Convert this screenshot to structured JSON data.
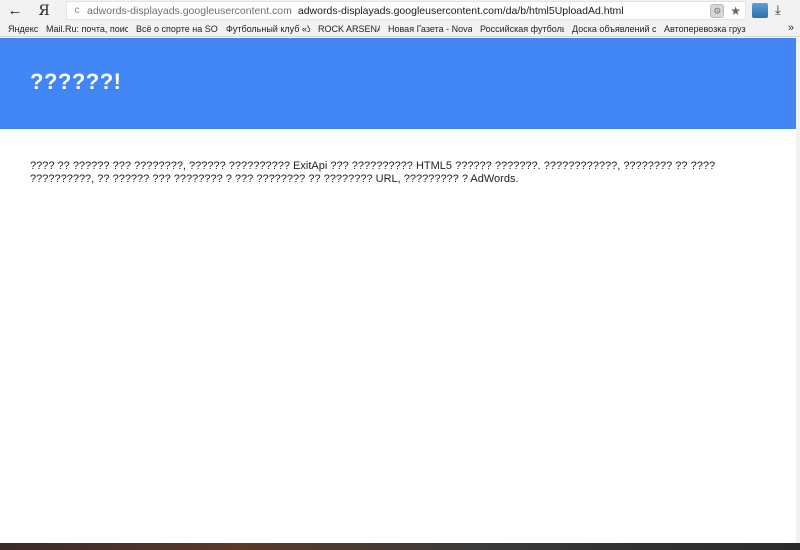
{
  "browser": {
    "back_icon": "←",
    "yandex_logo": "Я",
    "address": {
      "reload_icon": "c",
      "domain": "adwords-displayads.googleusercontent.com",
      "url": "adwords-displayads.googleusercontent.com/da/b/html5UploadAd.html"
    },
    "gear_icon": "⚙",
    "star_icon": "★",
    "download_icon": "⤓"
  },
  "bookmarks": [
    {
      "label": "Яндекс"
    },
    {
      "label": "Mail.Ru: почта, поиск"
    },
    {
      "label": "Всё о спорте на SOV"
    },
    {
      "label": "Футбольный клуб «У"
    },
    {
      "label": "ROCK ARSENAL"
    },
    {
      "label": "Новая Газета - Nova"
    },
    {
      "label": "Российская футболь"
    },
    {
      "label": "Доска объявлений с"
    },
    {
      "label": "Автоперевозка груз"
    }
  ],
  "bookmarks_more": "»",
  "page": {
    "title": "??????!",
    "body": "???? ?? ?????? ??? ????????, ?????? ?????????? ExitApi ??? ?????????? HTML5 ?????? ???????. ????????????, ???????? ?? ???? ??????????, ?? ?????? ??? ???????? ? ??? ???????? ?? ???????? URL, ????????? ? AdWords."
  },
  "colors": {
    "header": "#4285f4"
  }
}
